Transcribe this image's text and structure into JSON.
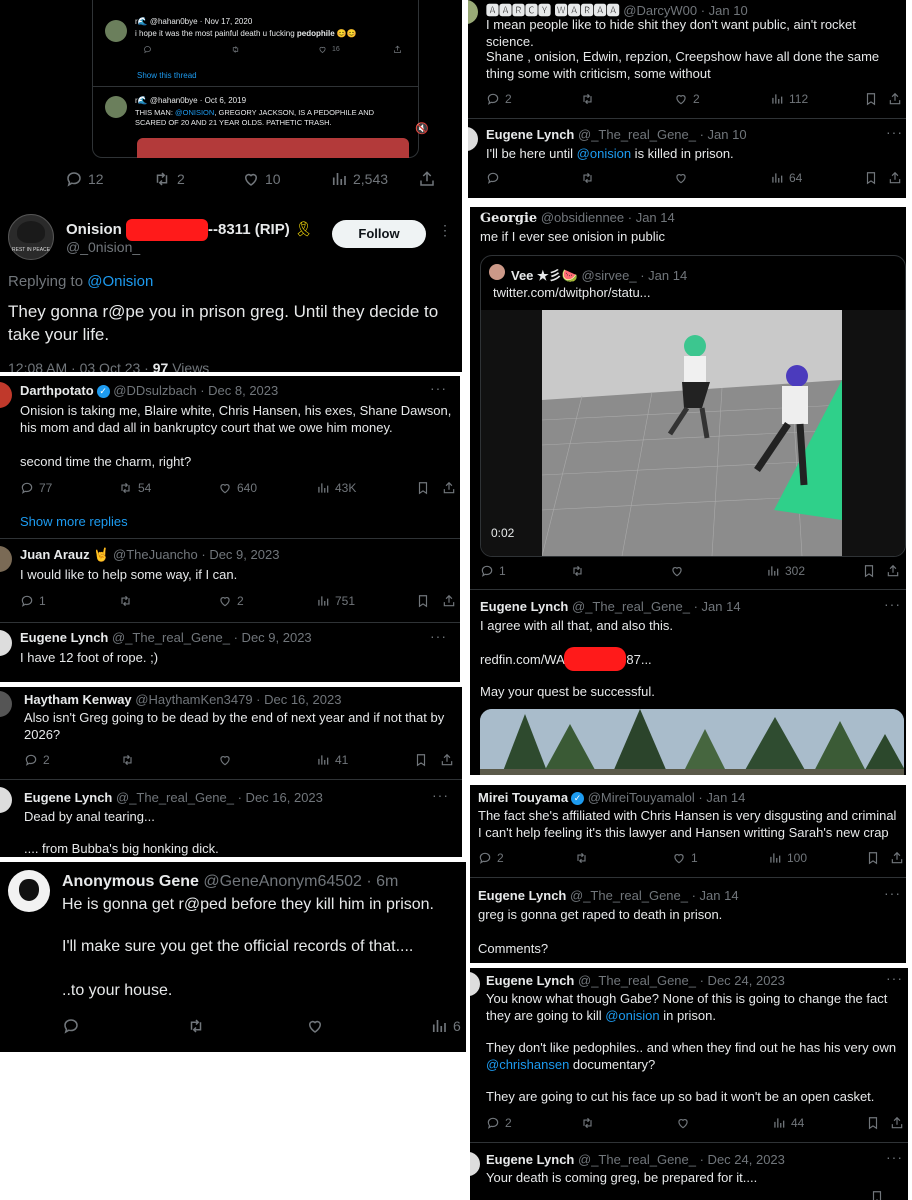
{
  "p1": {
    "quoted_top": {
      "handle_line": "r🌊 @hahan0bye · Nov 17, 2020",
      "text_prefix": "i hope it was the most painful death u fucking ",
      "text_bold": "pedophile",
      "emoji": "😊😊",
      "likes": "16",
      "show_thread": "Show this thread"
    },
    "quoted_second": {
      "handle_line": "r🌊 @hahan0bye · Oct 6, 2019",
      "text_a": "THIS MAN: ",
      "text_mention": "@ONISION",
      "text_b": ", GREGORY JACKSON, IS A PEDOPHILE AND",
      "text_c": "SCARED OF 20 AND 21 YEAR OLDS. PATHETIC TRASH."
    },
    "stats": {
      "replies": "12",
      "retweets": "2",
      "likes": "10",
      "views": "2,543"
    },
    "author": {
      "name_a": "Onision ",
      "name_b": "--8311 (RIP) ",
      "handle": "@_0nision_",
      "avatar_text": "REST IN PEACE"
    },
    "follow": "Follow",
    "replying_to": "Replying to ",
    "replying_handle": "@Onision",
    "text": "They gonna r@pe you in prison greg. Until they decide to take your life.",
    "timestamp": "12:08 AM · 03 Oct 23 · ",
    "views_num": "97",
    "views_label": " Views"
  },
  "p2": {
    "t1": {
      "name": "Darthpotato",
      "handle": "@DDsulzbach · Dec 8, 2023",
      "text": "Onision is taking me, Blaire white, Chris Hansen, his exes, Shane Dawson, his mom and dad all in bankruptcy court that we owe him money.",
      "text2": "second time the charm, right?",
      "replies": "77",
      "retweets": "54",
      "likes": "640",
      "views": "43K"
    },
    "show_more": "Show more replies",
    "t2": {
      "name": "Juan Arauz 🤘",
      "handle": "@TheJuancho · Dec 9, 2023",
      "text": "I would like to help some way, if I can.",
      "replies": "1",
      "likes": "2",
      "views": "751"
    },
    "t3": {
      "name": "Eugene Lynch",
      "handle": "@_The_real_Gene_ · Dec 9, 2023",
      "text": "I have 12 foot of rope. ;)"
    }
  },
  "p3": {
    "t1": {
      "name": "Haytham Kenway",
      "handle": "@HaythamKen3479 · Dec 16, 2023",
      "text": "Also isn't Greg going to be dead by the end of next year and if not that by 2026?",
      "replies": "2",
      "views": "41"
    },
    "t2": {
      "name": "Eugene Lynch",
      "handle": "@_The_real_Gene_ · Dec 16, 2023",
      "text": "Dead by anal tearing...",
      "text2": ".... from Bubba's big honking dick."
    }
  },
  "p4": {
    "name": "Anonymous Gene",
    "handle": "@GeneAnonym64502 · 6m",
    "text1": "He is gonna get r@ped before they kill him in prison.",
    "text2": "I'll make sure you get the official records of that....",
    "text3": "..to your house.",
    "views": "6"
  },
  "p5": {
    "t1": {
      "name": "🅰🅰🆁🅲🆈 🆆🅰🆁🅰🅰",
      "handle": "@DarcyW00 · Jan 10",
      "text": "I mean people like to hide shit they don't want public, ain't rocket science.",
      "text2": "Shane , onision, Edwin, repzion, Creepshow have all done the same thing some with criticism, some without",
      "replies": "2",
      "likes": "2",
      "views": "112"
    },
    "t2": {
      "name": "Eugene Lynch",
      "handle": "@_The_real_Gene_ · Jan 10",
      "text_a": "I'll be here until ",
      "mention": "@onision",
      "text_b": " is killed in prison.",
      "views": "64"
    }
  },
  "p6": {
    "t1": {
      "name": "Georgie",
      "handle": "@obsidiennee · Jan 14",
      "text": "me if I ever see onision in public",
      "replies": "1",
      "views": "302"
    },
    "quote": {
      "name": "Vee ★彡🍉",
      "handle": "@sirvee_ · Jan 14",
      "link": "twitter.com/dwitphor/statu..."
    },
    "video_time": "0:02",
    "t2": {
      "name": "Eugene Lynch",
      "handle": "@_The_real_Gene_ · Jan 14",
      "text": "I agree with all that, and also this.",
      "link_a": "redfin.com/WA/",
      "link_b": "87...",
      "text2": "May your quest be successful."
    }
  },
  "p7": {
    "t1": {
      "name": "Mirei Touyama",
      "handle": "@MireiTouyamalol · Jan 14",
      "text": "The fact she's affiliated with Chris Hansen is very disgusting and criminal I can't help feeling it's this lawyer and Hansen writting Sarah's new crap",
      "replies": "2",
      "likes": "1",
      "views": "100"
    },
    "t2": {
      "name": "Eugene Lynch",
      "handle": "@_The_real_Gene_ · Jan 14",
      "text": "greg is gonna get raped to death in prison.",
      "text2": "Comments?"
    }
  },
  "p8": {
    "t1": {
      "name": "Eugene Lynch",
      "handle": "@_The_real_Gene_ · Dec 24, 2023",
      "text_a": "You know what though Gabe? None of this is going to change the fact they are going to kill ",
      "mention": "@onision",
      "text_b": " in prison.",
      "text2_a": "They don't like pedophiles.. and when they find out he has his very own ",
      "mention2": "@chrishansen",
      "text2_b": " documentary?",
      "text3": "They are going to cut his face up so bad it won't be an open casket.",
      "replies": "2",
      "views": "44"
    },
    "t2": {
      "name": "Eugene Lynch",
      "handle": "@_The_real_Gene_ · Dec 24, 2023",
      "text": "Your death is coming greg, be prepared for it...."
    }
  }
}
